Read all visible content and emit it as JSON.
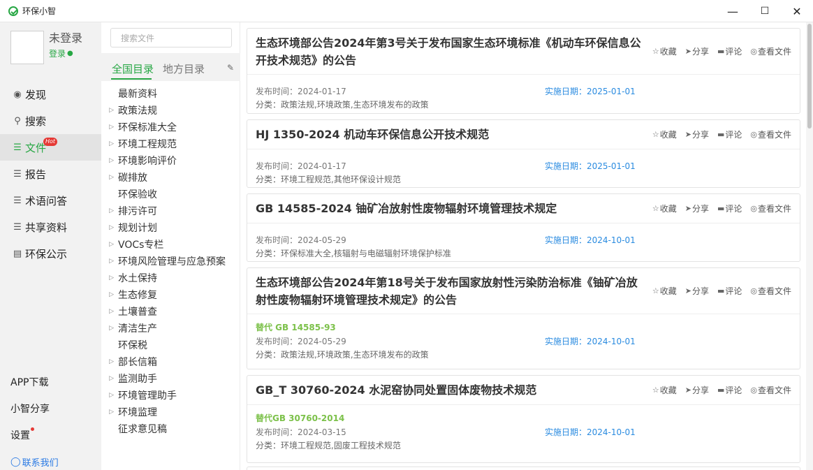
{
  "window": {
    "title": "环保小智",
    "minimize": "—",
    "maximize": "☐",
    "close": "✕"
  },
  "user": {
    "name": "未登录",
    "login": "登录"
  },
  "nav": [
    {
      "label": "发现",
      "icon": "eye-icon"
    },
    {
      "label": "搜索",
      "icon": "search-icon"
    },
    {
      "label": "文件",
      "icon": "layers-icon",
      "active": true,
      "badge": "Hot"
    },
    {
      "label": "报告",
      "icon": "layers-icon"
    },
    {
      "label": "术语问答",
      "icon": "layers-icon"
    },
    {
      "label": "共享资料",
      "icon": "layers-icon"
    },
    {
      "label": "环保公示",
      "icon": "building-icon"
    }
  ],
  "bottom_links": {
    "app_download": "APP下载",
    "share": "小智分享",
    "settings": "设置",
    "contact": "联系我们"
  },
  "search": {
    "placeholder": "搜索文件"
  },
  "tabs": {
    "national": "全国目录",
    "local": "地方目录"
  },
  "directory": [
    {
      "label": "最新资料",
      "expandable": false
    },
    {
      "label": "政策法规",
      "expandable": true
    },
    {
      "label": "环保标准大全",
      "expandable": true
    },
    {
      "label": "环境工程规范",
      "expandable": true
    },
    {
      "label": "环境影响评价",
      "expandable": true
    },
    {
      "label": "碳排放",
      "expandable": true
    },
    {
      "label": "环保验收",
      "expandable": false
    },
    {
      "label": "排污许可",
      "expandable": true
    },
    {
      "label": "规划计划",
      "expandable": true
    },
    {
      "label": "VOCs专栏",
      "expandable": true
    },
    {
      "label": "环境风险管理与应急预案",
      "expandable": true
    },
    {
      "label": "水土保持",
      "expandable": true
    },
    {
      "label": "生态修复",
      "expandable": true
    },
    {
      "label": "土壤普查",
      "expandable": true
    },
    {
      "label": "清洁生产",
      "expandable": true
    },
    {
      "label": "环保税",
      "expandable": false
    },
    {
      "label": "部长信箱",
      "expandable": true
    },
    {
      "label": "监测助手",
      "expandable": true
    },
    {
      "label": "环境管理助手",
      "expandable": true
    },
    {
      "label": "环境监理",
      "expandable": true
    },
    {
      "label": "征求意见稿",
      "expandable": false
    }
  ],
  "actions": {
    "favorite": "收藏",
    "share": "分享",
    "comment": "评论",
    "view": "查看文件"
  },
  "labels": {
    "publish": "发布时间：",
    "implement": "实施日期：",
    "category": "分类："
  },
  "documents": [
    {
      "title_lines": [
        "生态环境部公告2024年第3号关于发布国家生态环境标准《机动车环保信息公",
        "开技术规范》的公告"
      ],
      "replaces": "",
      "publish_date": "2024-01-17",
      "implement_date": "2025-01-01",
      "category": "政策法规,环境政策,生态环境发布的政策"
    },
    {
      "title_lines": [
        "HJ 1350-2024 机动车环保信息公开技术规范"
      ],
      "replaces": "",
      "publish_date": "2024-01-17",
      "implement_date": "2025-01-01",
      "category": "环境工程规范,其他环保设计规范"
    },
    {
      "title_lines": [
        "GB 14585-2024 铀矿冶放射性废物辐射环境管理技术规定"
      ],
      "replaces": "",
      "publish_date": "2024-05-29",
      "implement_date": "2024-10-01",
      "category": "环保标准大全,核辐射与电磁辐射环境保护标准"
    },
    {
      "title_lines": [
        "生态环境部公告2024年第18号关于发布国家放射性污染防治标准《铀矿冶放",
        "射性废物辐射环境管理技术规定》的公告"
      ],
      "replaces": "替代 GB 14585-93",
      "publish_date": "2024-05-29",
      "implement_date": "2024-10-01",
      "category": "政策法规,环境政策,生态环境发布的政策"
    },
    {
      "title_lines": [
        "GB_T 30760-2024 水泥窑协同处置固体废物技术规范"
      ],
      "replaces": "替代GB 30760-2014",
      "publish_date": "2024-03-15",
      "implement_date": "2024-10-01",
      "category": "环境工程规范,固废工程技术规范"
    }
  ]
}
